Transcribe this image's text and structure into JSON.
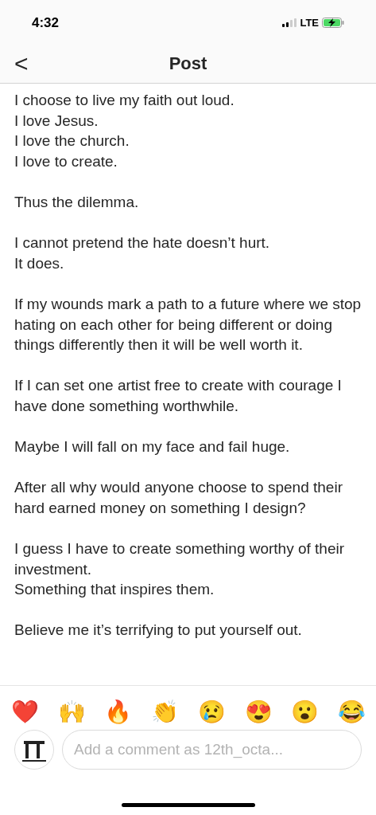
{
  "status_bar": {
    "time": "4:32",
    "network": "LTE"
  },
  "nav_bar": {
    "back": "<",
    "title": "Post"
  },
  "caption": [
    [
      "I choose to live my faith out loud.",
      "I love Jesus.",
      "I love the church.",
      "I love to create."
    ],
    [
      "Thus the dilemma."
    ],
    [
      "I cannot pretend the hate doesn’t hurt.",
      "It does."
    ],
    [
      "If my wounds mark a path to a future where we stop hating on each other for being different or doing things differently then it will be well worth it."
    ],
    [
      "If I can set one artist free to create with courage I have done something worthwhile."
    ],
    [
      "Maybe I will fall on my face and fail huge."
    ],
    [
      "After all why would anyone choose to spend their hard earned money on something I design?"
    ],
    [
      "I guess I have to create something worthy of their investment.",
      "Something that inspires them."
    ],
    [
      "Believe me it’s terrifying to put yourself out."
    ]
  ],
  "reactions": [
    "❤️",
    "🙌",
    "🔥",
    "👏",
    "😢",
    "😍",
    "😮",
    "😂"
  ],
  "comment": {
    "placeholder": "Add a comment as 12th_octa..."
  }
}
